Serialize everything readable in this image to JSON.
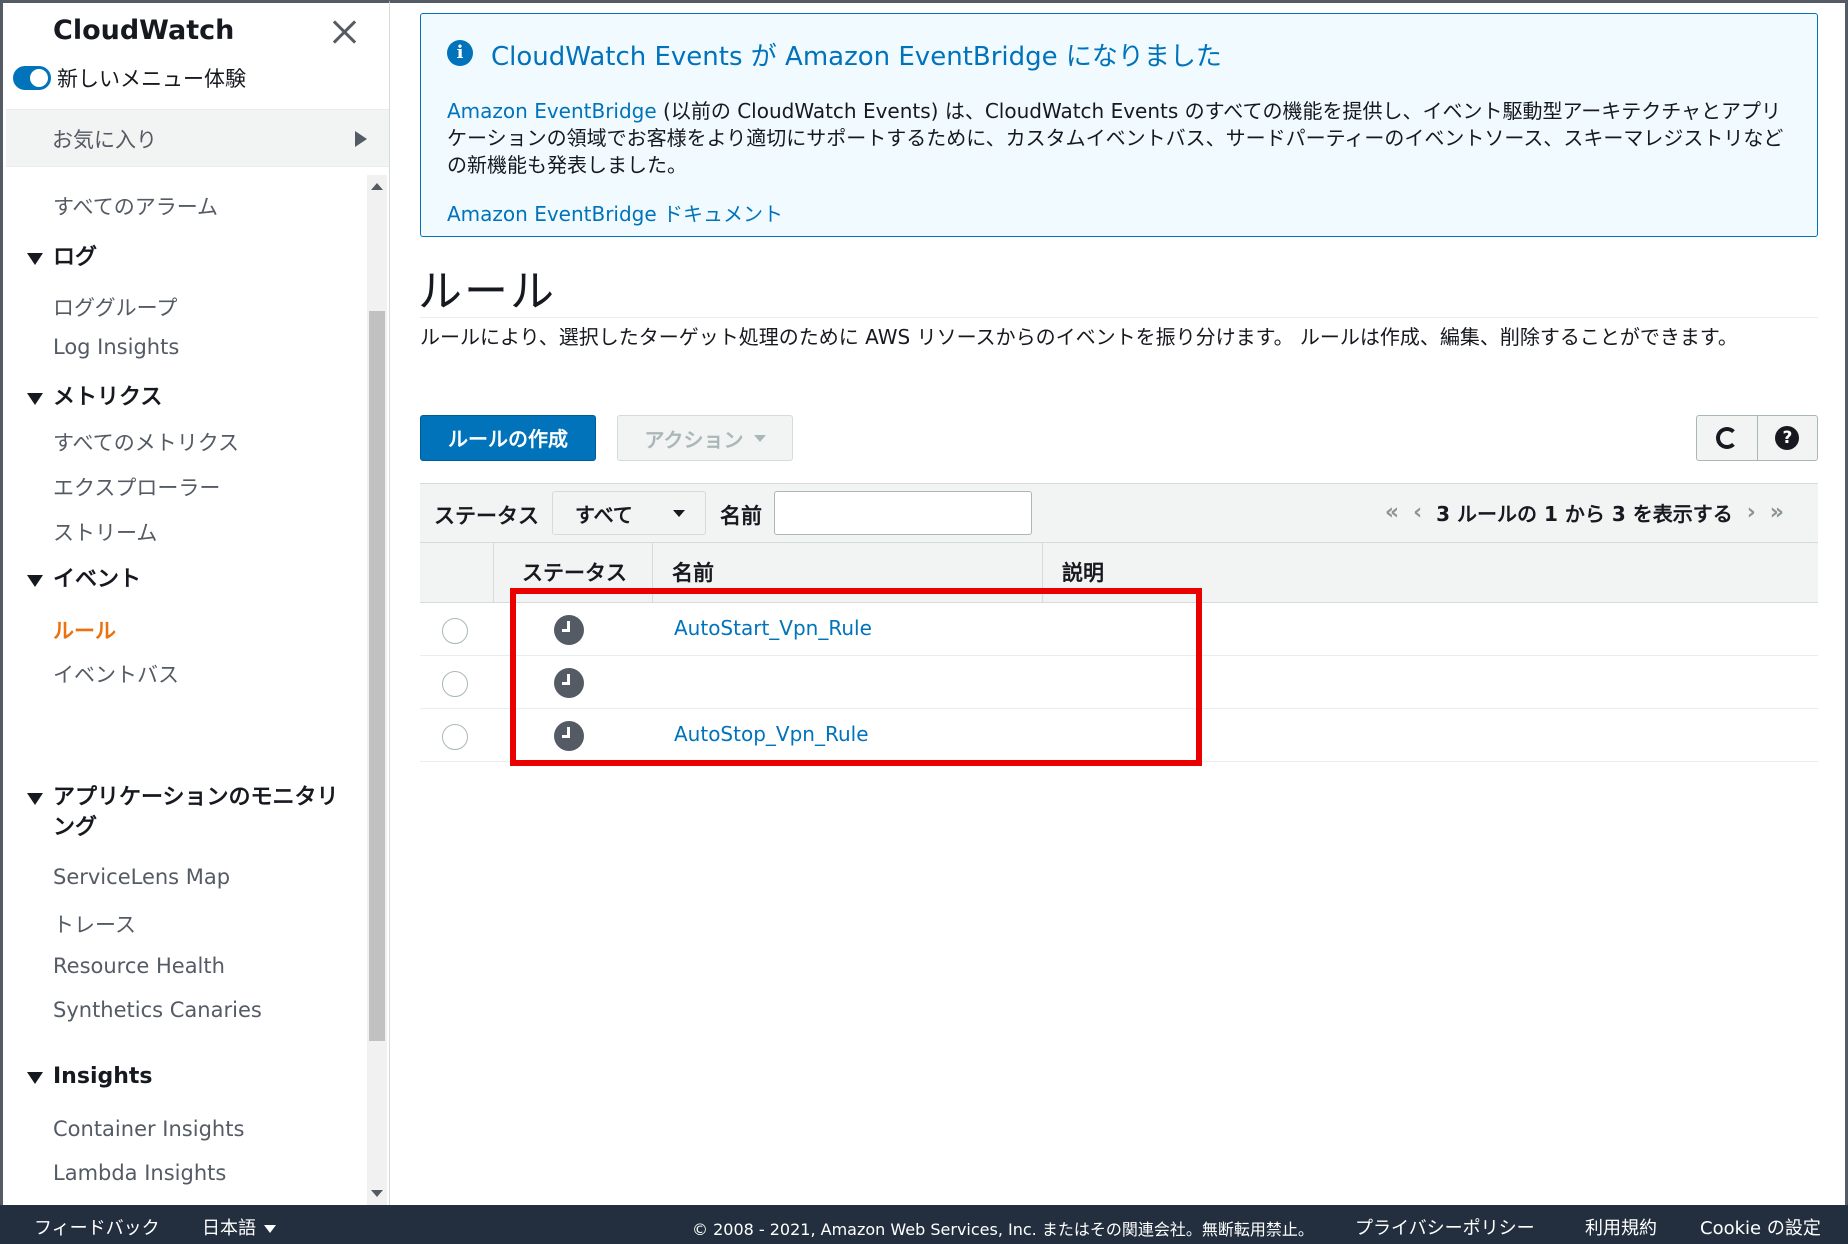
{
  "sidebar": {
    "title": "CloudWatch",
    "new_menu_label": "新しいメニュー体験",
    "favorites_label": "お気に入り",
    "all_alarms": "すべてのアラーム",
    "logs_group": "ログ",
    "log_groups": "ロググループ",
    "log_insights": "Log Insights",
    "metrics_group": "メトリクス",
    "all_metrics": "すべてのメトリクス",
    "explorer": "エクスプローラー",
    "streams": "ストリーム",
    "events_group": "イベント",
    "rules": "ルール",
    "event_bus": "イベントバス",
    "app_monitoring_group_line1": "アプリケーションのモニタリ",
    "app_monitoring_group_line2": "ング",
    "servicelens_map": "ServiceLens Map",
    "traces": "トレース",
    "resource_health": "Resource Health",
    "synthetics_canaries": "Synthetics Canaries",
    "insights_group": "Insights",
    "container_insights": "Container Insights",
    "lambda_insights": "Lambda Insights"
  },
  "banner": {
    "title": "CloudWatch Events が Amazon EventBridge になりました",
    "body_link": "Amazon EventBridge",
    "body_text": " (以前の CloudWatch Events) は、CloudWatch Events のすべての機能を提供し、イベント駆動型アーキテクチャとアプリケーションの領域でお客様をより適切にサポートするために、カスタムイベントバス、サードパーティーのイベントソース、スキーマレジストリなどの新機能も発表しました。",
    "doc_link": "Amazon EventBridge ドキュメント"
  },
  "page": {
    "title": "ルール",
    "description": "ルールにより、選択したターゲット処理のために AWS リソースからのイベントを振り分けます。 ルールは作成、編集、削除することができます。"
  },
  "toolbar": {
    "create_rule": "ルールの作成",
    "actions": "アクション",
    "refresh_icon": "refresh-icon",
    "help_icon": "help-icon"
  },
  "filter": {
    "status_label": "ステータス",
    "status_value": "すべて",
    "name_label": "名前",
    "name_value": "",
    "pagination": "3 ルールの 1 から 3 を表示する"
  },
  "table": {
    "headers": [
      "ステータス",
      "名前",
      "説明"
    ],
    "rows": [
      {
        "status_icon": "clock-icon",
        "name": "AutoStart_Vpn_Rule",
        "description": ""
      },
      {
        "status_icon": "clock-icon",
        "name": "",
        "description": ""
      },
      {
        "status_icon": "clock-icon",
        "name": "AutoStop_Vpn_Rule",
        "description": ""
      }
    ]
  },
  "footer": {
    "feedback": "フィードバック",
    "language": "日本語",
    "copyright": "© 2008 - 2021, Amazon Web Services, Inc. またはその関連会社。無断転用禁止。",
    "privacy": "プライバシーポリシー",
    "terms": "利用規約",
    "cookie": "Cookie の設定"
  },
  "colors": {
    "accent": "#0073bb",
    "active_nav": "#ec7211",
    "highlight": "#ea0000",
    "footer_bg": "#232f3e"
  }
}
